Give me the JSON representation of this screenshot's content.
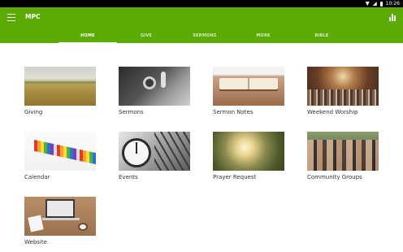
{
  "status_bar": {
    "time": "10:26"
  },
  "app_bar": {
    "title": "MPC",
    "menu_icon": "hamburger-menu-icon",
    "right_icon": "bar-chart-icon"
  },
  "tabs": [
    {
      "label": "HOME",
      "active": true
    },
    {
      "label": "GIVE",
      "active": false
    },
    {
      "label": "SERMONS",
      "active": false
    },
    {
      "label": "MORE",
      "active": false
    },
    {
      "label": "BIBLE",
      "active": false
    }
  ],
  "tiles": [
    {
      "label": "Giving"
    },
    {
      "label": "Sermons"
    },
    {
      "label": "Sermon Notes"
    },
    {
      "label": "Weekend Worship"
    },
    {
      "label": "Calendar"
    },
    {
      "label": "Events"
    },
    {
      "label": "Prayer Request"
    },
    {
      "label": "Community Groups"
    },
    {
      "label": "Website"
    }
  ],
  "colors": {
    "app_bar": "#5cab05",
    "status_bar": "#000000",
    "background": "#ffffff"
  }
}
